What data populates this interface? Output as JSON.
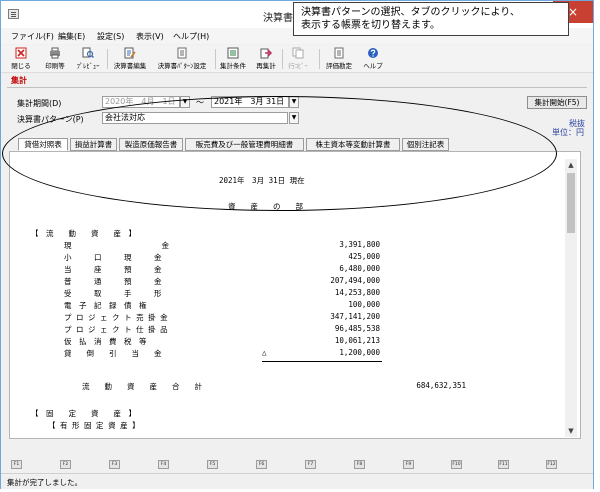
{
  "window": {
    "title": "決算書",
    "close_glyph": "×"
  },
  "menu": [
    "ファイル(F)",
    "編集(E)",
    "設定(S)",
    "表示(V)",
    "ヘルプ(H)"
  ],
  "toolbar": [
    {
      "label": "閉じる",
      "icon": "close-icon",
      "color": "#cc2222"
    },
    {
      "label": "印刷等",
      "icon": "printer-icon",
      "color": "#5a5a5a"
    },
    {
      "label": "ﾌﾟﾚﾋﾞｭｰ",
      "icon": "preview-icon",
      "color": "#5a5a5a"
    },
    {
      "label": "決算書編集",
      "icon": "edit-icon",
      "color": "#3b6db3"
    },
    {
      "label": "決算書ﾊﾟﾀｰﾝ設定",
      "icon": "pattern-icon",
      "color": "#6b6b6b"
    },
    {
      "label": "集計条件",
      "icon": "condition-icon",
      "color": "#2f7f4a"
    },
    {
      "label": "再集計",
      "icon": "recalc-icon",
      "color": "#c03a6b"
    },
    {
      "label": "行ｺﾋﾟｰ",
      "icon": "copy-icon",
      "color": "#aaaaaa",
      "disabled": true
    },
    {
      "label": "評価勘定",
      "icon": "evaluation-icon",
      "color": "#6b6b6b"
    },
    {
      "label": "ヘルプ",
      "icon": "help-icon",
      "color": "#2a5fc4"
    }
  ],
  "section_label": "集計",
  "period": {
    "label": "集計期間(D)",
    "from": "2020年　4月　1日",
    "tilde": "〜",
    "to": "2021年　3月 31日"
  },
  "pattern": {
    "label": "決算書パターン(P)",
    "value": "会社法対応"
  },
  "run_button": "集計開始(F5)",
  "tax_note": "税抜",
  "unit_note": "単位：円",
  "tabs": [
    "貸借対照表",
    "損益計算書",
    "製造原価報告書",
    "販売費及び一般管理費明細書",
    "株主資本等変動計算書",
    "個別注記表"
  ],
  "report": {
    "date_line": "2021年　3月 31日 現在",
    "section_title": "資　　産　　の　　部",
    "flow_header": "【　流　　動　　資　　産　】",
    "items": [
      {
        "name": "現　　　　　　　　　　　　金",
        "value": "3,391,800"
      },
      {
        "name": "小　　　口　　　現　　　金",
        "value": "425,000"
      },
      {
        "name": "当　　　座　　　預　　　金",
        "value": "6,480,000"
      },
      {
        "name": "普　　　通　　　預　　　金",
        "value": "207,494,000"
      },
      {
        "name": "受　　　取　　　手　　　形",
        "value": "14,253,800"
      },
      {
        "name": "電　子　記　録　債　権",
        "value": "100,000"
      },
      {
        "name": "プ ロ ジ ェ ク ト 売 掛 金",
        "value": "347,141,200"
      },
      {
        "name": "プ ロ ジ ェ ク ト 仕 掛 品",
        "value": "96,485,538"
      },
      {
        "name": "仮　払　消　費　税　等",
        "value": "10,061,213"
      },
      {
        "name": "貸　　倒　　引　　当　　金",
        "value": "1,200,000",
        "negative_mark": "△"
      }
    ],
    "total_label": "流　　動　　資　　産　　合　　計",
    "total_value": "684,632,351",
    "fixed_header": "【　固　　定　　資　　産　】",
    "tangible_header": "【 有 形 固 定 資 産 】"
  },
  "fkeys": [
    "F1",
    "F2",
    "F3",
    "F4",
    "F5",
    "F6",
    "F7",
    "F8",
    "F9",
    "F10",
    "F11",
    "F12"
  ],
  "status": "集計が完了しました。",
  "callout": {
    "line1": "決算書パターンの選択、タブのクリックにより、",
    "line2": "表示する帳票を切り替えます。"
  }
}
